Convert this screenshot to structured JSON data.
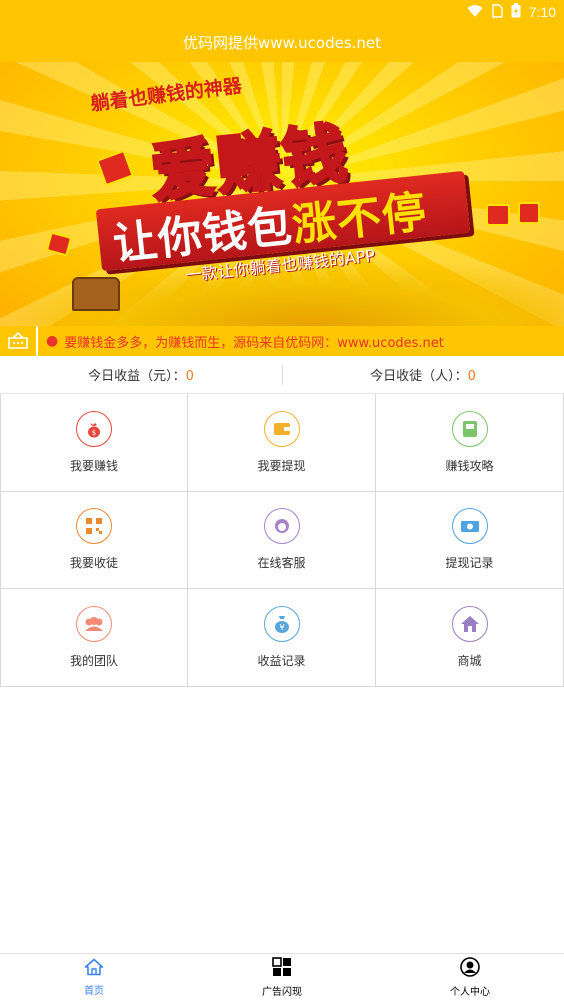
{
  "status_bar": {
    "time": "7:10"
  },
  "title": "优码网提供www.ucodes.net",
  "banner": {
    "slogan": "躺着也赚钱的神器",
    "headline": "爱赚钱",
    "tagline_a": "让你钱包",
    "tagline_b": "涨不停",
    "subtitle": "一款让你躺着也赚钱的APP"
  },
  "notice": {
    "text": "要赚钱金多多，为赚钱而生，源码来自优码网：www.ucodes.net"
  },
  "stats": {
    "income_label": "今日收益（元）：",
    "income_value": "0",
    "apprentice_label": "今日收徒（人）：",
    "apprentice_value": "0"
  },
  "menu": [
    {
      "label": "我要赚钱",
      "icon": "money-bag-icon",
      "color": "#E8463C"
    },
    {
      "label": "我要提现",
      "icon": "wallet-icon",
      "color": "#F2B12B"
    },
    {
      "label": "赚钱攻略",
      "icon": "guide-book-icon",
      "color": "#7CC46A"
    },
    {
      "label": "我要收徒",
      "icon": "qr-code-icon",
      "color": "#E98A2E"
    },
    {
      "label": "在线客服",
      "icon": "customer-service-icon",
      "color": "#A783C9"
    },
    {
      "label": "提现记录",
      "icon": "cash-record-icon",
      "color": "#4FA3E0"
    },
    {
      "label": "我的团队",
      "icon": "team-icon",
      "color": "#F28A75"
    },
    {
      "label": "收益记录",
      "icon": "income-record-icon",
      "color": "#5AA6D8"
    },
    {
      "label": "商城",
      "icon": "home-store-icon",
      "color": "#9B7FC4"
    }
  ],
  "tabs": [
    {
      "label": "首页",
      "icon": "home-icon",
      "active": true
    },
    {
      "label": "广告闪现",
      "icon": "grid-icon",
      "active": false
    },
    {
      "label": "个人中心",
      "icon": "user-icon",
      "active": false
    }
  ]
}
